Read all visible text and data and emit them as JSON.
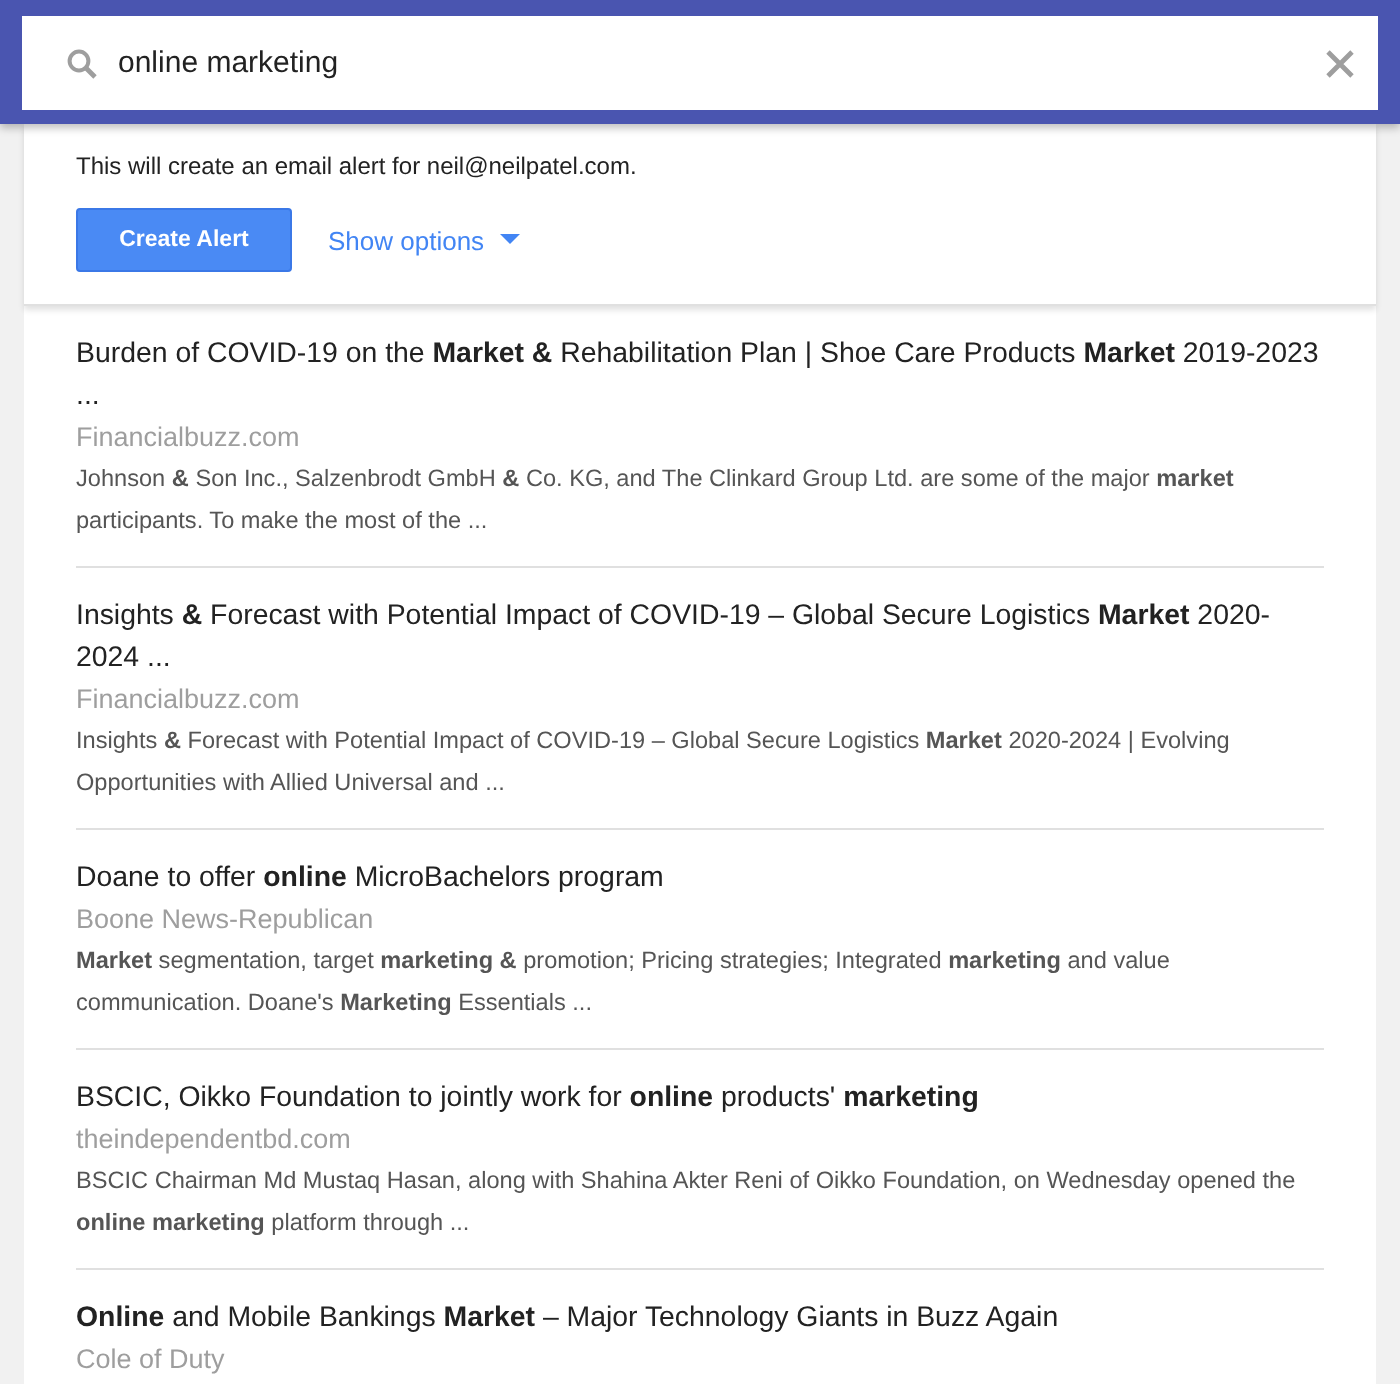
{
  "search": {
    "value": "online marketing"
  },
  "alert": {
    "message": "This will create an email alert for neil@neilpatel.com.",
    "create_button": "Create Alert",
    "options_link": "Show options"
  },
  "results": [
    {
      "title": "Burden of COVID-19 on the **Market &** Rehabilitation Plan | Shoe Care Products **Market** 2019-2023 ...",
      "source": "Financialbuzz.com",
      "snippet": "Johnson **&** Son Inc., Salzenbrodt GmbH **&** Co. KG, and The Clinkard Group Ltd. are some of the major **market** participants. To make the most of the ..."
    },
    {
      "title": "Insights **&** Forecast with Potential Impact of COVID-19 – Global Secure Logistics **Market** 2020-2024 ...",
      "source": "Financialbuzz.com",
      "snippet": "Insights **&** Forecast with Potential Impact of COVID-19 – Global Secure Logistics **Market** 2020-2024 | Evolving Opportunities with Allied Universal and ..."
    },
    {
      "title": "Doane to offer **online** MicroBachelors program",
      "source": "Boone News-Republican",
      "snippet": "**Market** segmentation, target **marketing &** promotion; Pricing strategies; Integrated **marketing** and value communication. Doane's **Marketing** Essentials ..."
    },
    {
      "title": "BSCIC, Oikko Foundation to jointly work for **online** products' **marketing**",
      "source": "theindependentbd.com",
      "snippet": "BSCIC Chairman Md Mustaq Hasan, along with Shahina Akter Reni of Oikko Foundation, on Wednesday opened the **online marketing** platform through ..."
    },
    {
      "title": "**Online** and Mobile Bankings **Market** – Major Technology Giants in Buzz Again",
      "source": "Cole of Duty"
    }
  ]
}
